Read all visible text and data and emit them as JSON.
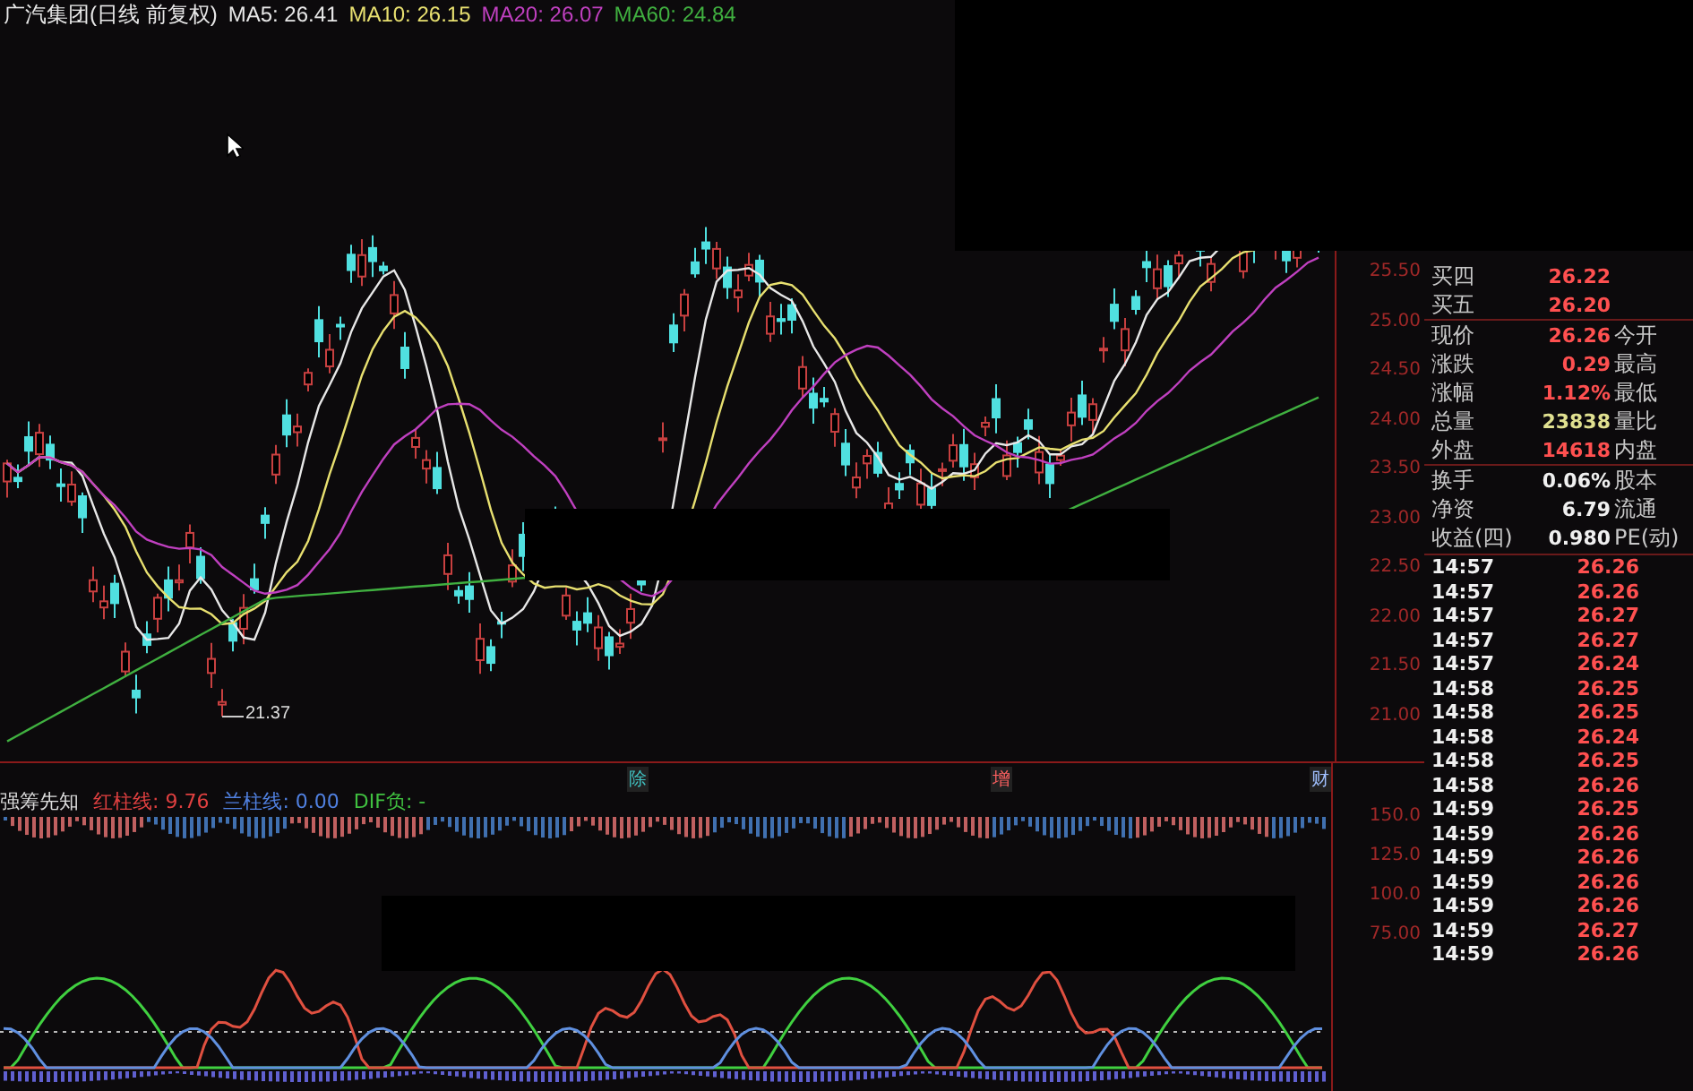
{
  "chart_header": {
    "title": "广汽集团(日线 前复权)",
    "indicators": [
      {
        "label": "MA5: 26.41",
        "color": "#e8e8e8"
      },
      {
        "label": "MA10: 26.15",
        "color": "#e8e070"
      },
      {
        "label": "MA20: 26.07",
        "color": "#c040c0"
      },
      {
        "label": "MA60: 24.84",
        "color": "#40b040"
      }
    ]
  },
  "price_axis": [
    "25.50",
    "25.00",
    "24.50",
    "24.00",
    "23.50",
    "23.00",
    "22.50",
    "22.00",
    "21.50",
    "21.00"
  ],
  "low_marker": "21.37",
  "event_markers": [
    {
      "label": "除",
      "color": "#40c0c0"
    },
    {
      "label": "增",
      "color": "#ff6060"
    },
    {
      "label": "财",
      "color": "#a0c0ff"
    }
  ],
  "indicator": {
    "name": "强筹先知",
    "legend": [
      {
        "label": "红柱线: 9.76",
        "color": "#e04040"
      },
      {
        "label": "兰柱线: 0.00",
        "color": "#5080e0"
      },
      {
        "label": "DIF负: -",
        "color": "#40c040"
      }
    ]
  },
  "indicator_axis": [
    "150.0",
    "125.0",
    "100.0",
    "75.00"
  ],
  "quote_sections": [
    {
      "rows": [
        {
          "label": "买四",
          "value": "26.22",
          "kind": "price"
        },
        {
          "label": "买五",
          "value": "26.20",
          "kind": "price"
        }
      ]
    },
    {
      "rows": [
        {
          "label": "现价",
          "value": "26.26",
          "kind": "price",
          "side_label": "今开"
        },
        {
          "label": "涨跌",
          "value": "0.29",
          "kind": "price",
          "side_label": "最高"
        },
        {
          "label": "涨幅",
          "value": "1.12%",
          "kind": "price",
          "side_label": "最低"
        },
        {
          "label": "总量",
          "value": "23838",
          "kind": "volume",
          "side_label": "量比"
        },
        {
          "label": "外盘",
          "value": "14618",
          "kind": "price",
          "side_label": "内盘"
        }
      ]
    },
    {
      "rows": [
        {
          "label": "换手",
          "value": "0.06%",
          "kind": "plain",
          "side_label": "股本"
        },
        {
          "label": "净资",
          "value": "6.79",
          "kind": "plain",
          "side_label": "流通"
        },
        {
          "label": "收益(四)",
          "value": "0.980",
          "kind": "plain",
          "side_label": "PE(动)"
        }
      ]
    }
  ],
  "ticks": [
    {
      "time": "14:57",
      "price": "26.26"
    },
    {
      "time": "14:57",
      "price": "26.26"
    },
    {
      "time": "14:57",
      "price": "26.27"
    },
    {
      "time": "14:57",
      "price": "26.27"
    },
    {
      "time": "14:57",
      "price": "26.24"
    },
    {
      "time": "14:58",
      "price": "26.25"
    },
    {
      "time": "14:58",
      "price": "26.25"
    },
    {
      "time": "14:58",
      "price": "26.24"
    },
    {
      "time": "14:58",
      "price": "26.25"
    },
    {
      "time": "14:58",
      "price": "26.26"
    },
    {
      "time": "14:59",
      "price": "26.25"
    },
    {
      "time": "14:59",
      "price": "26.26"
    },
    {
      "time": "14:59",
      "price": "26.26"
    },
    {
      "time": "14:59",
      "price": "26.26"
    },
    {
      "time": "14:59",
      "price": "26.26"
    },
    {
      "time": "14:59",
      "price": "26.27"
    },
    {
      "time": "14:59",
      "price": "26.26"
    }
  ]
}
